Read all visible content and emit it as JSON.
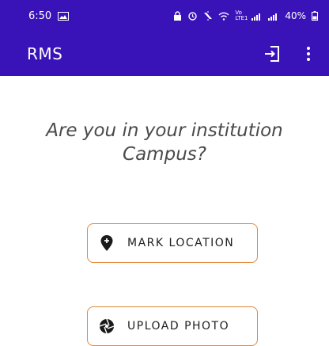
{
  "status_bar": {
    "time": "6:50",
    "network_label": "Vo LTE1",
    "battery": "40%"
  },
  "app_bar": {
    "title": "RMS",
    "logout_icon": "logout-icon",
    "menu_icon": "more-vertical-icon"
  },
  "main": {
    "question_line1": "Are you in your institution",
    "question_line2": "Campus?",
    "mark_location_label": "MARK LOCATION",
    "mark_location_icon": "location-pin-icon",
    "upload_photo_label": "UPLOAD PHOTO",
    "upload_photo_icon": "camera-aperture-icon"
  },
  "colors": {
    "primary": "#3a13b8",
    "button_border": "#e2873a",
    "text_muted": "#4a4a4a"
  }
}
